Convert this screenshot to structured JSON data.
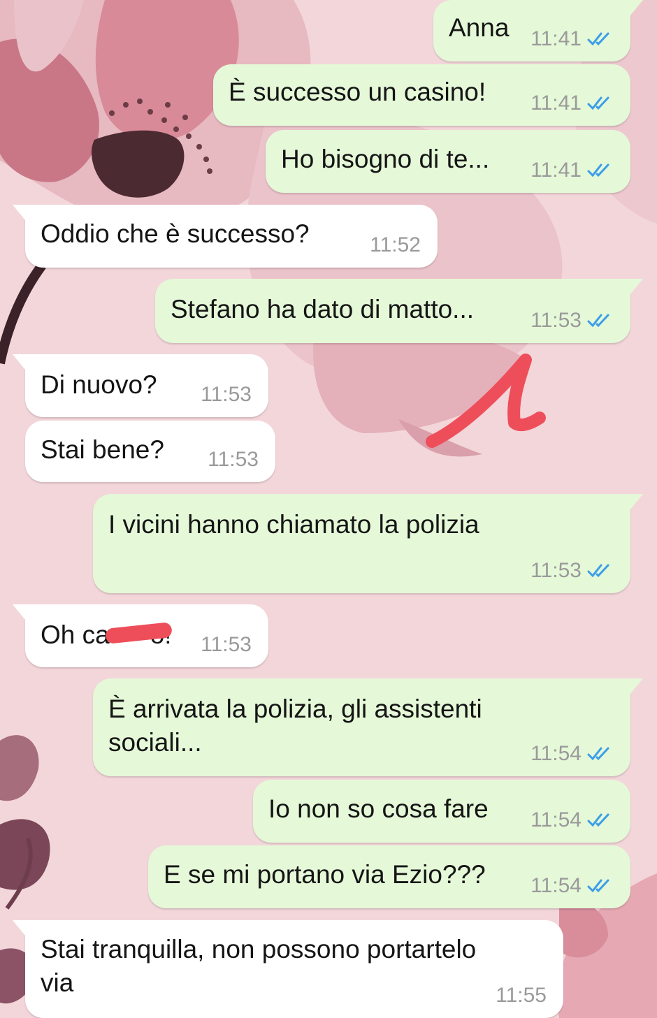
{
  "theme": {
    "outgoing_bubble": "#e5f8d8",
    "incoming_bubble": "#ffffff",
    "wallpaper": "#f3d6da",
    "read_ticks": "#3a9ee8",
    "annotation": "#ee4e5a"
  },
  "messages": [
    {
      "dir": "out",
      "text": "Anna",
      "time": "11:41",
      "status": "read-ticks-icon"
    },
    {
      "dir": "out",
      "text": "È successo un casino!",
      "time": "11:41",
      "status": "read-ticks-icon"
    },
    {
      "dir": "out",
      "text": "Ho bisogno di te...",
      "time": "11:41",
      "status": "read-ticks-icon"
    },
    {
      "dir": "in",
      "text": "Oddio che è successo?",
      "time": "11:52"
    },
    {
      "dir": "out",
      "text": "Stefano ha dato di matto...",
      "time": "11:53",
      "status": "read-ticks-icon"
    },
    {
      "dir": "in",
      "text": "Di nuovo?",
      "time": "11:53"
    },
    {
      "dir": "in",
      "text": "Stai bene?",
      "time": "11:53"
    },
    {
      "dir": "out",
      "text": "I vicini hanno chiamato la polizia",
      "time": "11:53",
      "status": "read-ticks-icon"
    },
    {
      "dir": "in",
      "text": "Oh ca",
      "text_tail": "o!",
      "time": "11:53",
      "redacted": true
    },
    {
      "dir": "out",
      "text": "È arrivata la polizia, gli assistenti",
      "text2": "sociali...",
      "time": "11:54",
      "status": "read-ticks-icon"
    },
    {
      "dir": "out",
      "text": "Io non so cosa fare",
      "time": "11:54",
      "status": "read-ticks-icon"
    },
    {
      "dir": "out",
      "text": "E se mi portano via Ezio???",
      "time": "11:54",
      "status": "read-ticks-icon"
    },
    {
      "dir": "in",
      "text": "Stai tranquilla, non possono portartelo",
      "text2": "via",
      "time": "11:55"
    }
  ]
}
